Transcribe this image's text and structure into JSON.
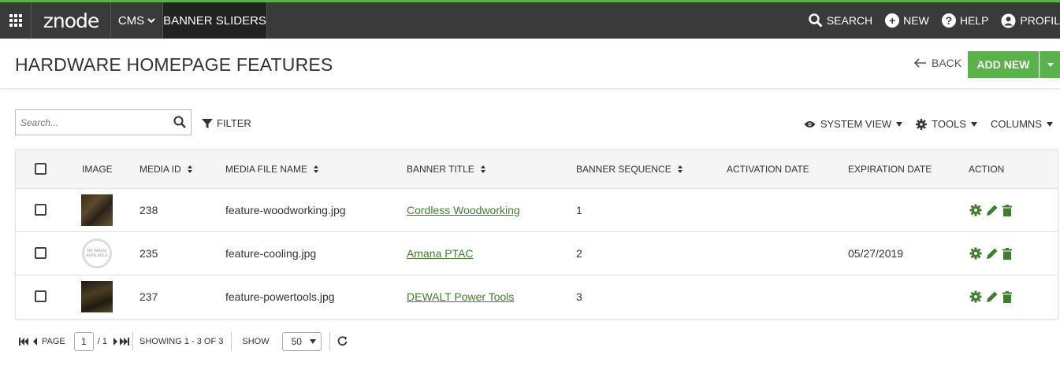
{
  "nav": {
    "logo": "znode",
    "cms": "CMS",
    "current": "BANNER SLIDERS",
    "search": "SEARCH",
    "new": "NEW",
    "help": "HELP",
    "profile": "PROFIL"
  },
  "header": {
    "title": "HARDWARE HOMEPAGE FEATURES",
    "back": "BACK",
    "add_new": "ADD NEW"
  },
  "toolbar": {
    "search_placeholder": "Search...",
    "filter": "FILTER",
    "system_view": "SYSTEM VIEW",
    "tools": "TOOLS",
    "columns": "COLUMNS"
  },
  "grid": {
    "columns": {
      "image": "IMAGE",
      "media_id": "MEDIA ID",
      "media_file_name": "MEDIA FILE NAME",
      "banner_title": "BANNER TITLE",
      "banner_sequence": "BANNER SEQUENCE",
      "activation_date": "ACTIVATION DATE",
      "expiration_date": "EXPIRATION DATE",
      "action": "ACTION"
    },
    "rows": [
      {
        "media_id": "238",
        "file": "feature-woodworking.jpg",
        "title": "Cordless Woodworking",
        "sequence": "1",
        "activation": "",
        "expiration": ""
      },
      {
        "media_id": "235",
        "file": "feature-cooling.jpg",
        "title": "Amana PTAC",
        "sequence": "2",
        "activation": "",
        "expiration": "05/27/2019"
      },
      {
        "media_id": "237",
        "file": "feature-powertools.jpg",
        "title": "DEWALT Power Tools",
        "sequence": "3",
        "activation": "",
        "expiration": ""
      }
    ],
    "no_image_text": "NO IMAGE AVAILABLE"
  },
  "pager": {
    "page_label": "PAGE",
    "page_value": "1",
    "page_total": "/ 1",
    "showing": "SHOWING 1 - 3 OF 3",
    "show_label": "SHOW",
    "show_value": "50"
  },
  "colors": {
    "accent": "#5bb14a",
    "link": "#3e7f2e",
    "topbar": "#3a3a3a"
  }
}
